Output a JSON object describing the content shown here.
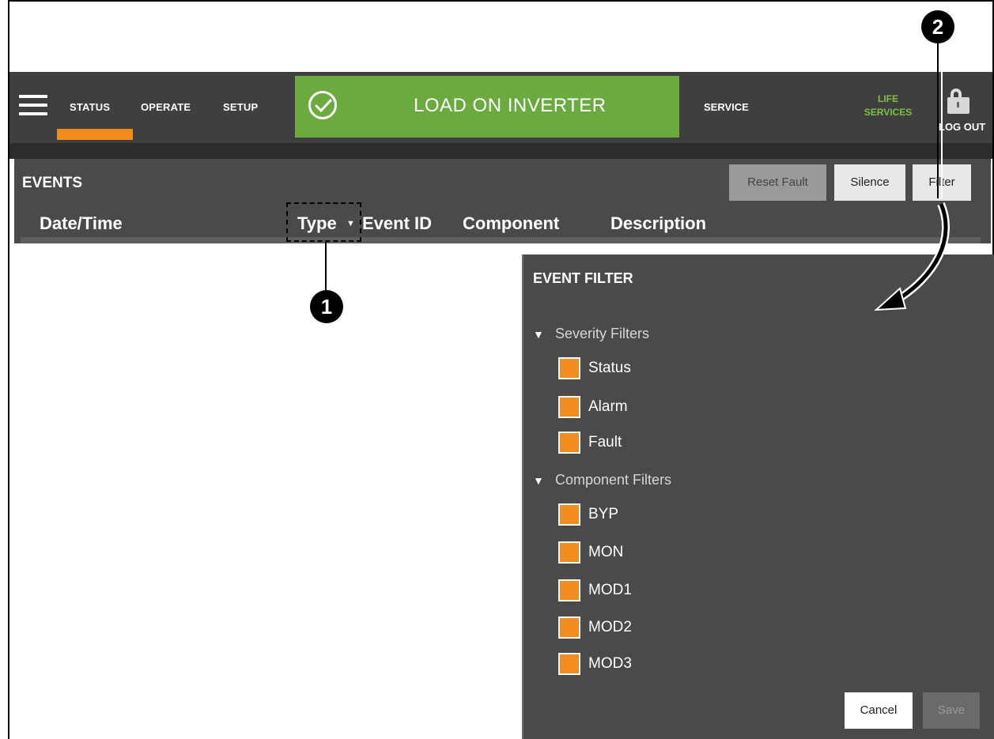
{
  "nav": {
    "items": [
      "STATUS",
      "OPERATE",
      "SETUP"
    ],
    "active": "STATUS",
    "status_banner": "LOAD ON INVERTER",
    "service": "SERVICE",
    "life_services_line1": "LIFE",
    "life_services_line2": "SERVICES",
    "logout": "LOG OUT"
  },
  "events": {
    "title": "EVENTS",
    "buttons": {
      "reset_fault": "Reset Fault",
      "silence": "Silence",
      "filter": "Filter"
    },
    "columns": [
      "Date/Time",
      "Type",
      "Event ID",
      "Component",
      "Description"
    ]
  },
  "callouts": {
    "one": "1",
    "two": "2"
  },
  "event_filter": {
    "title": "EVENT FILTER",
    "severity_header": "Severity Filters",
    "severity_items": [
      "Status",
      "Alarm",
      "Fault"
    ],
    "component_header": "Component Filters",
    "component_items": [
      "BYP",
      "MON",
      "MOD1",
      "MOD2",
      "MOD3"
    ],
    "cancel": "Cancel",
    "save": "Save"
  },
  "colors": {
    "accent_orange": "#f28c1f",
    "status_green": "#6aaa3f",
    "life_services_green": "#7dc242",
    "panel_gray": "#4a4a4a",
    "topbar_gray": "#3f3f3f"
  },
  "icons": [
    "menu-icon",
    "check-circle-icon",
    "lock-icon",
    "chevron-down-icon"
  ]
}
